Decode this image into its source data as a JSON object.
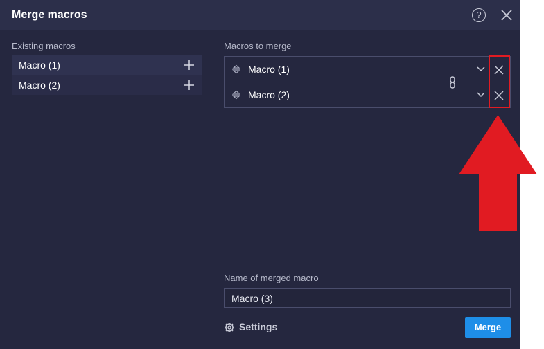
{
  "dialog": {
    "title": "Merge macros",
    "help_glyph": "?"
  },
  "existing": {
    "label": "Existing macros",
    "items": [
      {
        "label": "Macro (1)"
      },
      {
        "label": "Macro (2)"
      }
    ]
  },
  "to_merge": {
    "label": "Macros to merge",
    "items": [
      {
        "label": "Macro (1)"
      },
      {
        "label": "Macro (2)"
      }
    ]
  },
  "name_field": {
    "label": "Name of merged macro",
    "value": "Macro (3)"
  },
  "footer": {
    "settings_label": "Settings",
    "merge_label": "Merge"
  },
  "annotation": {
    "color": "#e11b22"
  },
  "colors": {
    "background": "#25273f",
    "accent": "#1e8ee8"
  }
}
